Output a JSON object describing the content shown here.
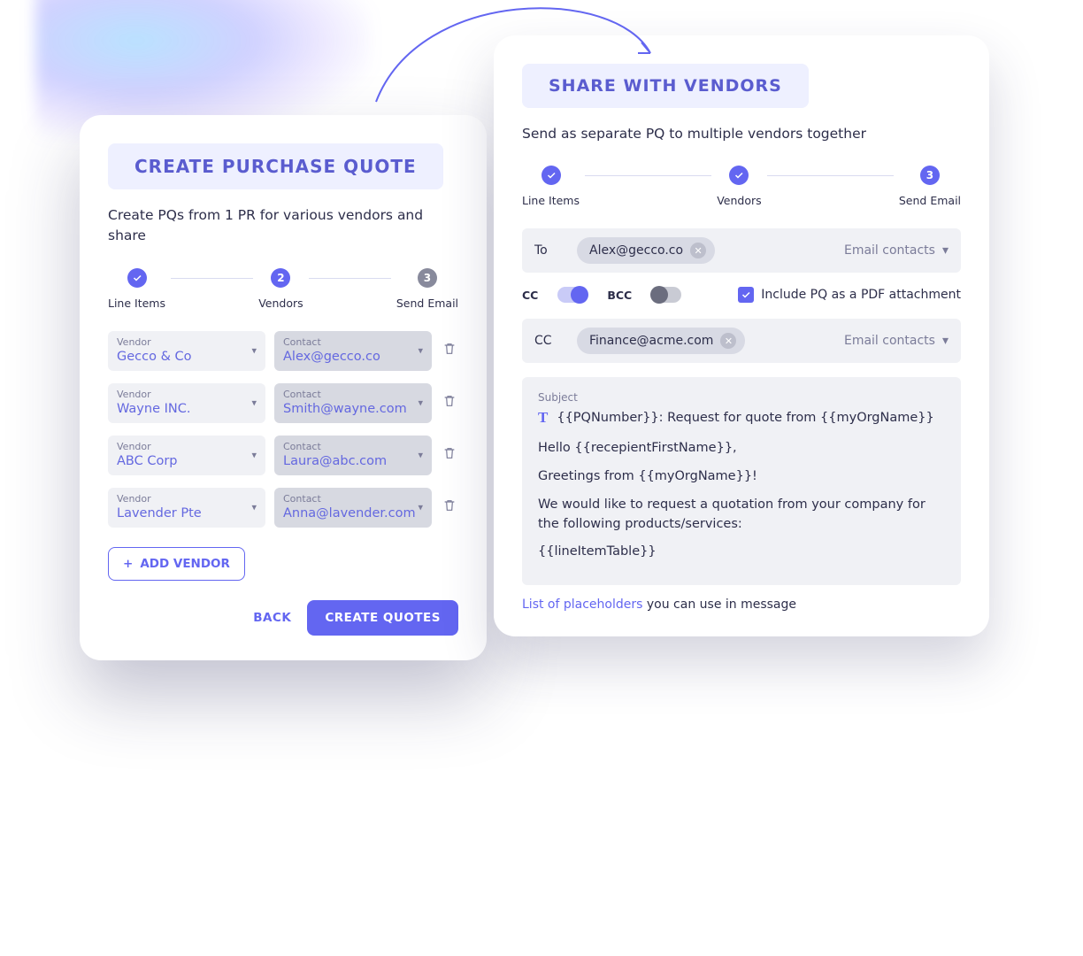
{
  "left": {
    "title": "CREATE PURCHASE QUOTE",
    "subtitle": "Create PQs from 1 PR for various vendors and share",
    "steps": [
      "Line Items",
      "Vendors",
      "Send Email"
    ],
    "step_state": [
      "done",
      "current",
      "pending"
    ],
    "step_numbers": [
      "",
      "2",
      "3"
    ],
    "vendor_label": "Vendor",
    "contact_label": "Contact",
    "rows": [
      {
        "vendor": "Gecco & Co",
        "contact": "Alex@gecco.co"
      },
      {
        "vendor": "Wayne INC.",
        "contact": "Smith@wayne.com"
      },
      {
        "vendor": "ABC Corp",
        "contact": "Laura@abc.com"
      },
      {
        "vendor": "Lavender Pte",
        "contact": "Anna@lavender.com"
      }
    ],
    "add_vendor": "ADD VENDOR",
    "back": "BACK",
    "create": "CREATE QUOTES"
  },
  "right": {
    "title": "SHARE WITH VENDORS",
    "subtitle": "Send as separate PQ to multiple vendors together",
    "steps": [
      "Line Items",
      "Vendors",
      "Send Email"
    ],
    "step_state": [
      "done",
      "done",
      "current"
    ],
    "step_numbers": [
      "",
      "",
      "3"
    ],
    "to_label": "To",
    "to_chip": "Alex@gecco.co",
    "email_contacts": "Email contacts",
    "cc_label": "CC",
    "bcc_label": "BCC",
    "pdf_label": "Include PQ as a PDF attachment",
    "cc_row_label": "CC",
    "cc_chip": "Finance@acme.com",
    "subject_label": "Subject",
    "subject": "{{PQNumber}}: Request for quote from {{myOrgName}}",
    "body": [
      "Hello {{recepientFirstName}},",
      "Greetings from {{myOrgName}}!",
      "We would like to request a quotation from your company for the following products/services:",
      "{{lineItemTable}}"
    ],
    "placeholder_link": "List of placeholders",
    "placeholder_rest": " you can use in message"
  }
}
